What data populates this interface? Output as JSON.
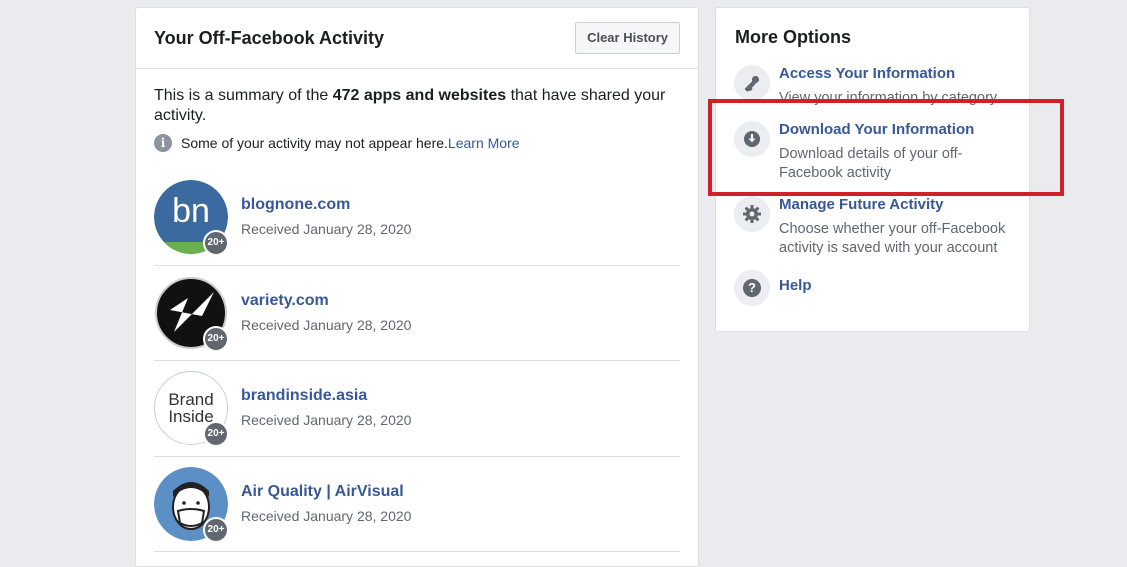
{
  "activity": {
    "title": "Your Off-Facebook Activity",
    "clear_button": "Clear History",
    "summary_prefix": "This is a summary of the ",
    "summary_bold": "472 apps and websites",
    "summary_suffix": " that have shared your activity.",
    "note_text": "Some of your activity may not appear here. ",
    "note_link": "Learn More",
    "info_glyph": "i",
    "apps": [
      {
        "name": "blognone.com",
        "date": "Received January 28, 2020",
        "badge": "20+",
        "avatar_text": "bn"
      },
      {
        "name": "variety.com",
        "date": "Received January 28, 2020",
        "badge": "20+",
        "avatar_text": "V"
      },
      {
        "name": "brandinside.asia",
        "date": "Received January 28, 2020",
        "badge": "20+",
        "avatar_line1": "Brand",
        "avatar_line2": "Inside"
      },
      {
        "name": "Air Quality | AirVisual",
        "date": "Received January 28, 2020",
        "badge": "20+"
      }
    ]
  },
  "more_options": {
    "title": "More Options",
    "items": [
      {
        "title": "Access Your Information",
        "desc": "View your information by category",
        "icon": "key-icon"
      },
      {
        "title": "Download Your Information",
        "desc": "Download details of your off-Facebook activity",
        "icon": "download-icon"
      },
      {
        "title": "Manage Future Activity",
        "desc": "Choose whether your off-Facebook activity is saved with your account",
        "icon": "gear-icon"
      },
      {
        "title": "Help",
        "desc": "",
        "icon": "help-icon",
        "glyph": "?"
      }
    ]
  },
  "colors": {
    "link": "#385898",
    "highlight": "#d0202a",
    "background": "#e9ebee"
  }
}
